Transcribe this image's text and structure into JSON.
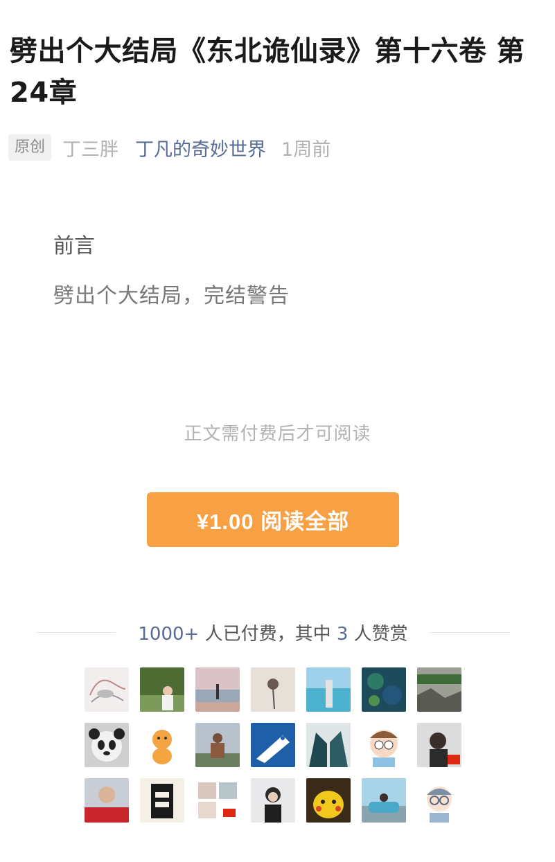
{
  "article": {
    "title": "劈出个大结局《东北诡仙录》第十六卷 第24章",
    "tag": "原创",
    "author": "丁三胖",
    "account": "丁凡的奇妙世界",
    "time": "1周前"
  },
  "preface": {
    "heading": "前言",
    "text": "劈出个大结局，完结警告"
  },
  "paywall": {
    "note": "正文需付费后才可阅读",
    "button_label": "¥1.00 阅读全部",
    "accent_color": "#f7a044"
  },
  "paid_stats": {
    "paid_count": "1000+",
    "paid_label": " 人已付费，其中 ",
    "reward_count": "3",
    "reward_label": " 人赞赏"
  },
  "avatars": [
    "avatar-sketch",
    "avatar-woman-greenery",
    "avatar-man-beach",
    "avatar-flower",
    "avatar-statue-sea",
    "avatar-blue-pattern",
    "avatar-nature",
    "avatar-panda",
    "avatar-cat",
    "avatar-man-hill",
    "avatar-fish-logo",
    "avatar-dark-cats",
    "avatar-cartoon-boy",
    "avatar-boy-flag",
    "avatar-man-red-banner",
    "avatar-poster",
    "avatar-collage",
    "avatar-woman-tree",
    "avatar-pikachu",
    "avatar-car",
    "avatar-cartoon-glasses"
  ]
}
